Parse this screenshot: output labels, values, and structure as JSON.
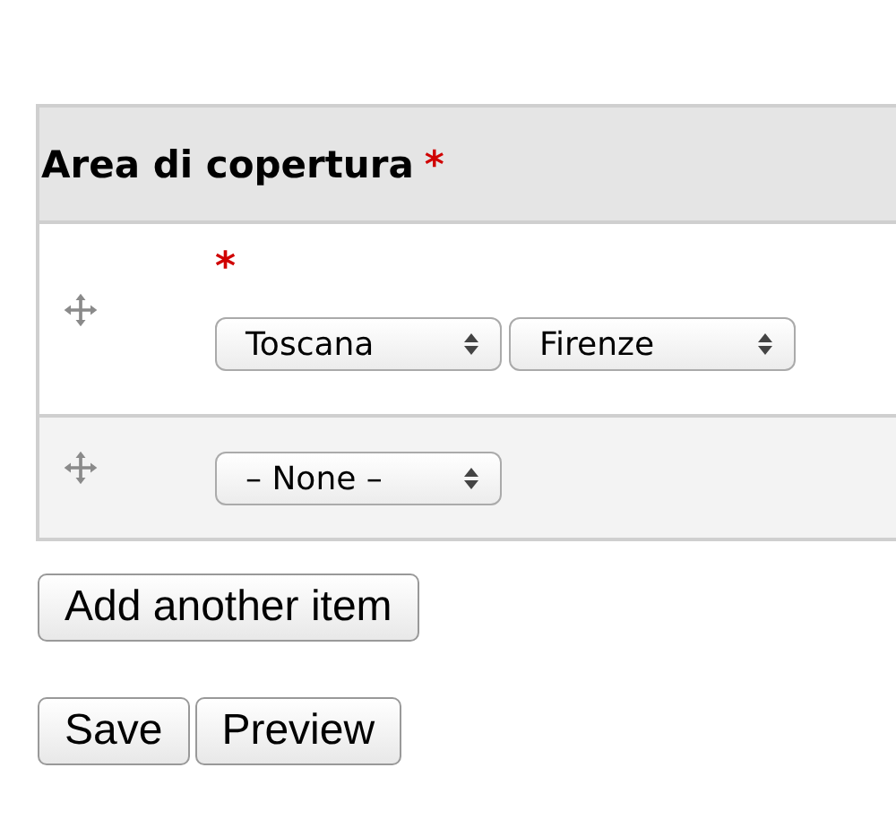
{
  "field": {
    "label": "Area di copertura",
    "required_mark": "*"
  },
  "rows": [
    {
      "required_mark": "*",
      "selects": [
        "Toscana",
        "Firenze"
      ]
    },
    {
      "selects": [
        "– None –"
      ]
    }
  ],
  "add_button": "Add another item",
  "buttons": [
    "Save",
    "Preview"
  ]
}
